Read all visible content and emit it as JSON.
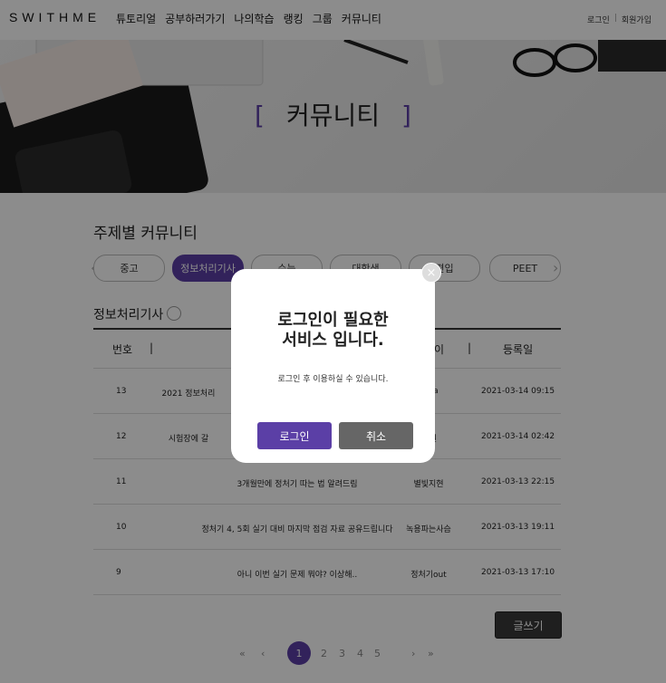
{
  "nav": {
    "logo": "SWITHME",
    "menu": [
      "튜토리얼",
      "공부하러가기",
      "나의학습",
      "랭킹",
      "그룹",
      "커뮤니티"
    ],
    "login": "로그인",
    "signup": "회원가입"
  },
  "hero": {
    "title": "커뮤니티",
    "bracket_left": "[",
    "bracket_right": "]"
  },
  "topics": {
    "title": "주제별 커뮤니티",
    "chips": [
      "중고",
      "정보처리기사",
      "수능",
      "대학생",
      "편입",
      "PEET"
    ],
    "active": "정보처리기사",
    "prev": "‹",
    "next": "›"
  },
  "board": {
    "title": "정보처리기사",
    "columns": [
      "번호",
      "|",
      "이",
      "|",
      "등록일"
    ],
    "rows": [
      {
        "num": "13",
        "title": "2021 정보처리",
        "author": "na",
        "date": "2021-03-14  09:15"
      },
      {
        "num": "12",
        "title": "시험장에 갈",
        "author": "원",
        "date": "2021-03-14  02:42"
      },
      {
        "num": "11",
        "title": "3개월만에 정처기 따는 법 알려드림",
        "author": "별빛지현",
        "date": "2021-03-13  22:15"
      },
      {
        "num": "10",
        "title": "정처기 4, 5회 실기 대비 마지막 점검 자료 공유드립니다",
        "author": "녹용파는사슴",
        "date": "2021-03-13  19:11"
      },
      {
        "num": "9",
        "title": "아니 이번 실기 문제 뭐야? 이상해..",
        "author": "정처기out",
        "date": "2021-03-13  17:10"
      }
    ],
    "write_button": "글쓰기"
  },
  "pagination": {
    "first": "«",
    "prev": "‹",
    "pages": [
      "1",
      "2",
      "3",
      "4",
      "5"
    ],
    "current": "1",
    "next": "›",
    "last": "»"
  },
  "modal": {
    "title_line1": "로그인이 필요한",
    "title_line2": "서비스 입니다.",
    "message": "로그인 후 이용하실 수 있습니다.",
    "login_button": "로그인",
    "cancel_button": "취소",
    "close": "×"
  },
  "colors": {
    "accent": "#5b3fa6",
    "dark_button": "#3a3a3a",
    "cancel_button": "#666666"
  }
}
